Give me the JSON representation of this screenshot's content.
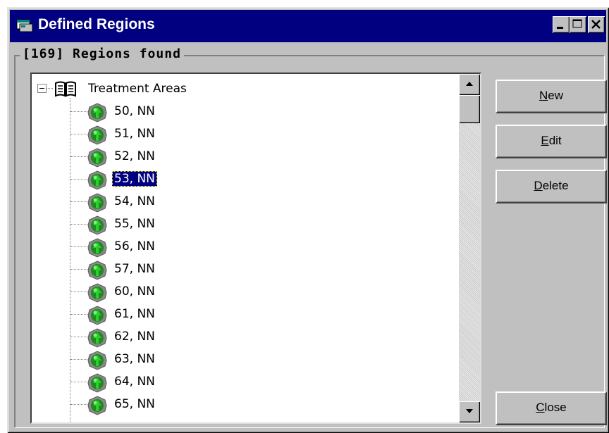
{
  "window": {
    "title": "Defined Regions",
    "icon": "app-icon",
    "controls": [
      "minimize",
      "maximize",
      "close"
    ]
  },
  "group": {
    "label": "[169] Regions found"
  },
  "tree": {
    "root": {
      "label": "Treatment Areas",
      "icon": "book-icon",
      "expanded": true
    },
    "items": [
      {
        "label": "50, NN"
      },
      {
        "label": "51, NN"
      },
      {
        "label": "52, NN"
      },
      {
        "label": "53, NN",
        "selected": true
      },
      {
        "label": "54, NN"
      },
      {
        "label": "55, NN"
      },
      {
        "label": "56, NN"
      },
      {
        "label": "57, NN"
      },
      {
        "label": "60, NN"
      },
      {
        "label": "61, NN"
      },
      {
        "label": "62, NN"
      },
      {
        "label": "63, NN"
      },
      {
        "label": "64, NN"
      },
      {
        "label": "65, NN"
      }
    ],
    "item_icon": "region-icon"
  },
  "buttons": {
    "new": {
      "mnemonic": "N",
      "rest": "ew"
    },
    "edit": {
      "mnemonic": "E",
      "rest": "dit"
    },
    "delete": {
      "mnemonic": "D",
      "rest": "elete"
    },
    "close": {
      "mnemonic": "C",
      "rest": "lose"
    }
  },
  "colors": {
    "titlebar": "#000080",
    "face": "#c0c0c0",
    "selection": "#000080"
  }
}
